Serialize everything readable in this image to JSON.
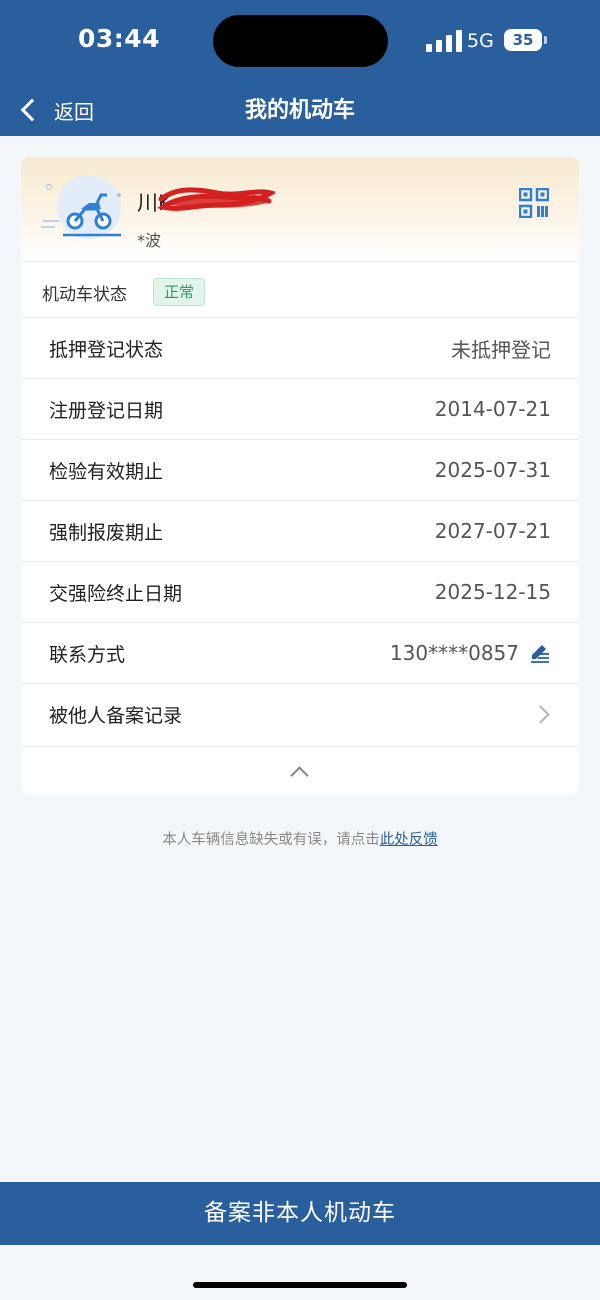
{
  "status_bar": {
    "time": "03:44",
    "network": "5G",
    "battery": "35"
  },
  "nav": {
    "back_label": "返回",
    "title": "我的机动车"
  },
  "vehicle": {
    "plate": "川K",
    "owner": "*波",
    "status_label": "机动车状态",
    "status_value": "正常"
  },
  "details": [
    {
      "label": "抵押登记状态",
      "value": "未抵押登记"
    },
    {
      "label": "注册登记日期",
      "value": "2014-07-21"
    },
    {
      "label": "检验有效期止",
      "value": "2025-07-31"
    },
    {
      "label": "强制报废期止",
      "value": "2027-07-21"
    },
    {
      "label": "交强险终止日期",
      "value": "2025-12-15"
    }
  ],
  "contact": {
    "label": "联系方式",
    "value": "130****0857"
  },
  "record": {
    "label": "被他人备案记录"
  },
  "feedback": {
    "text": "本人车辆信息缺失或有误，请点击",
    "link": "此处反馈"
  },
  "bottom_button": "备案非本人机动车",
  "colors": {
    "primary": "#2a5f9e",
    "badge_text": "#2f9b5d",
    "badge_bg": "#e3f5ea"
  }
}
